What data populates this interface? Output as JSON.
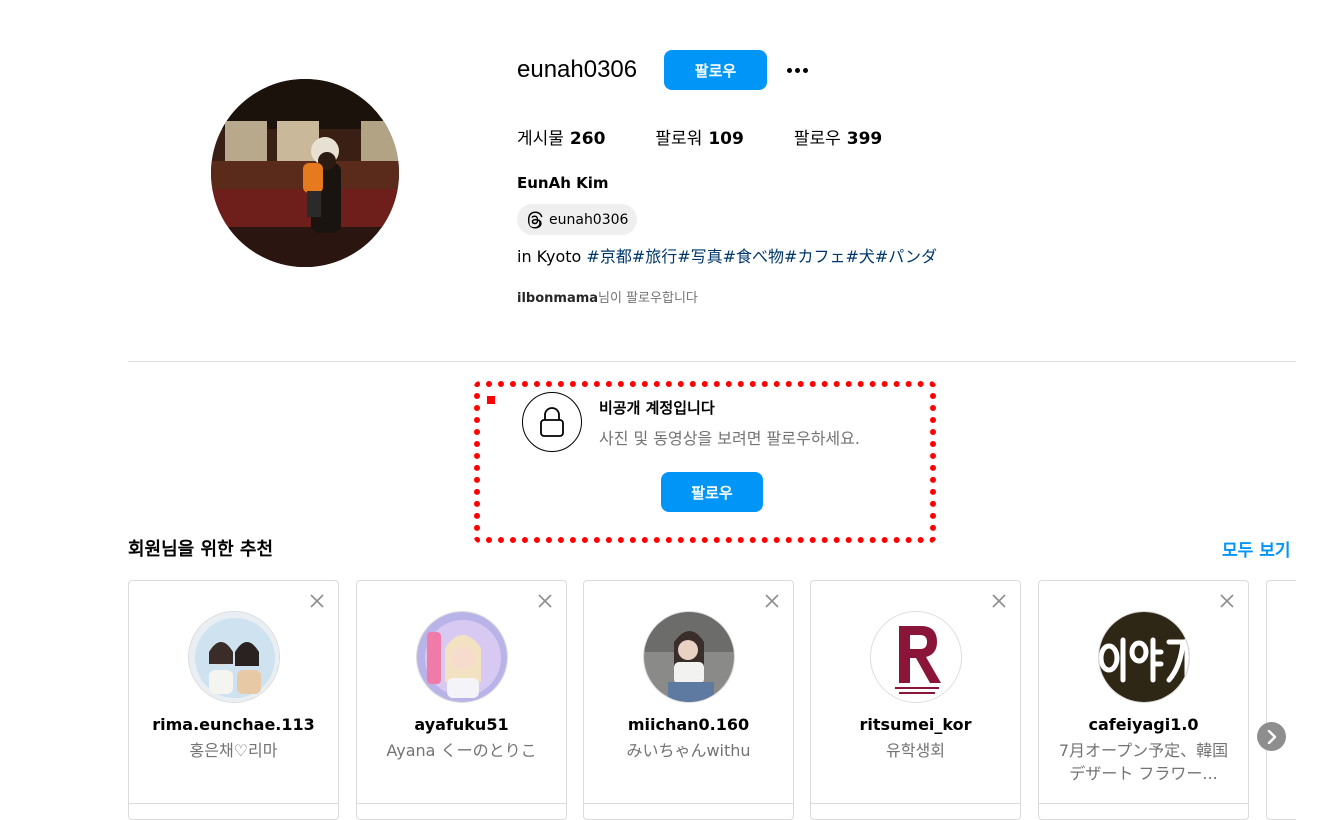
{
  "profile": {
    "username": "eunah0306",
    "follow_label": "팔로우",
    "more_icon": "more-horizontal-icon",
    "stats": [
      {
        "label": "게시물",
        "value": "260"
      },
      {
        "label": "팔로워",
        "value": "109"
      },
      {
        "label": "팔로우",
        "value": "399"
      }
    ],
    "full_name": "EunAh Kim",
    "threads_handle": "eunah0306",
    "bio_text": "in Kyoto ",
    "bio_tags": "#京都#旅行#写真#食べ物#カフェ#犬#パンダ",
    "followed_by_user": "ilbonmama",
    "followed_by_suffix": "님이 팔로우합니다"
  },
  "private_notice": {
    "title": "비공개 계정입니다",
    "subtitle": "사진 및 동영상을 보려면 팔로우하세요.",
    "follow_label": "팔로우",
    "highlight_color": "#ff0000"
  },
  "suggestions": {
    "heading": "회원님을 위한 추천",
    "see_all": "모두 보기",
    "items": [
      {
        "username": "rima.eunchae.113",
        "subtitle": "홍은채♡리마"
      },
      {
        "username": "ayafuku51",
        "subtitle": "Ayana くーのとりこ"
      },
      {
        "username": "miichan0.160",
        "subtitle": "みいちゃんwithu"
      },
      {
        "username": "ritsumei_kor",
        "subtitle": "유학생회"
      },
      {
        "username": "cafeiyagi1.0",
        "subtitle": "7月オープン予定、韓国デザート フラワー..."
      }
    ]
  },
  "colors": {
    "accent": "#0095f6",
    "hashtag": "#00376b",
    "muted": "#737373"
  }
}
